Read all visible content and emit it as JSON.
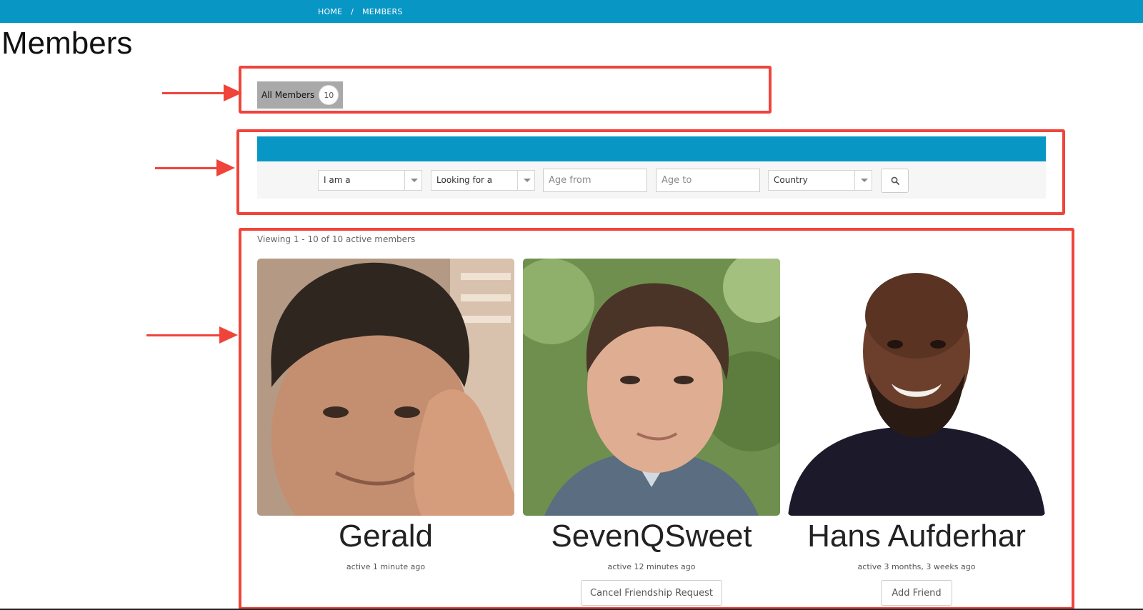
{
  "breadcrumb": {
    "home": "HOME",
    "separator": "/",
    "current": "MEMBERS"
  },
  "page": {
    "title": "Members"
  },
  "tabs": {
    "all_members": {
      "label": "All Members",
      "count": "10"
    }
  },
  "search": {
    "i_am_a": "I am a",
    "looking_for": "Looking for a",
    "age_from_placeholder": "Age from",
    "age_to_placeholder": "Age to",
    "country": "Country",
    "button_icon": "search-icon"
  },
  "results": {
    "viewing_text": "Viewing 1 - 10 of 10 active members"
  },
  "members": [
    {
      "name": "Gerald",
      "active": "active 1 minute ago",
      "button": ""
    },
    {
      "name": "SevenQSweet",
      "active": "active 12 minutes ago",
      "button": "Cancel Friendship Request"
    },
    {
      "name": "Hans Aufderhar",
      "active": "active 3 months, 3 weeks ago",
      "button": "Add Friend"
    }
  ],
  "colors": {
    "brand": "#0896c4",
    "annotation": "#f0443a"
  }
}
